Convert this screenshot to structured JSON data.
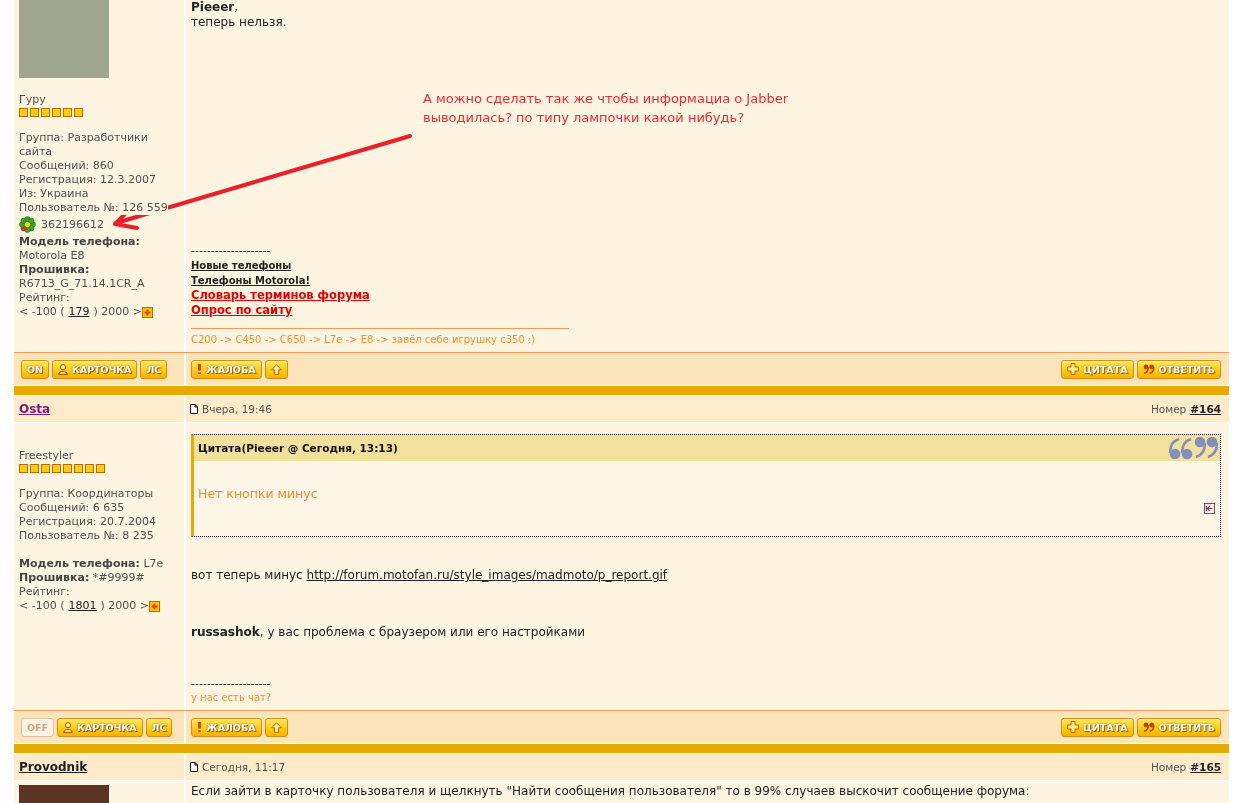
{
  "annotation": {
    "lines": [
      "А можно сделать так же чтобы информациа о Jabber",
      "выводилась? по типу лампочки какой нибудь?"
    ]
  },
  "posts": [
    {
      "avatar": true,
      "rank": "Гуру",
      "stars": 6,
      "profile": [
        [
          {
            "kind": "text",
            "text": "Группа: Разработчики сайта"
          },
          {
            "kind": "text",
            "text": "Сообщений: 860"
          },
          {
            "kind": "text",
            "text": "Регистрация: 12.3.2007"
          },
          {
            "kind": "text",
            "text": "Из: Украина"
          },
          {
            "kind": "text",
            "text": "Пользователь №: 126 559"
          },
          {
            "kind": "icq",
            "text": "362196612"
          },
          {
            "kind": "field",
            "label": "Модель телефона:",
            "value": "Motorola E8"
          },
          {
            "kind": "field",
            "label": "Прошивка:",
            "value": "R6713_G_71.14.1CR_A"
          },
          {
            "kind": "text",
            "text": "Рейтинг:"
          },
          {
            "kind": "rating",
            "before": "< -100 (",
            "value": "179",
            "after": ") 2000 >"
          }
        ]
      ],
      "blocks": [
        {
          "kind": "text",
          "lines": [
            "**Pieeer**,",
            "теперь нельзя."
          ]
        }
      ],
      "signature": [
        {
          "kind": "dashes",
          "text": "--------------------"
        },
        {
          "kind": "link",
          "text": "Новые телефоны"
        },
        {
          "kind": "link",
          "text": "Телефоны Motorola!"
        },
        {
          "kind": "promo",
          "text": "Словарь терминов форума"
        },
        {
          "kind": "promo",
          "text": "Опрос по сайту"
        },
        {
          "kind": "rule"
        },
        {
          "kind": "note",
          "text": "C200 -> C450 -> C650 -> L7e -> E8 -> завёл себе игрушку с350 :)"
        }
      ],
      "buttons": {
        "left": [
          {
            "kind": "status",
            "text": "ON",
            "on": true
          },
          {
            "kind": "profile",
            "text": "КАРТОЧКА"
          },
          {
            "kind": "pm",
            "text": "ЛС"
          }
        ],
        "middle": [
          {
            "kind": "report",
            "text": "ЖАЛОБА"
          },
          {
            "kind": "top"
          }
        ],
        "right": [
          {
            "kind": "quote",
            "text": "ЦИТАТА"
          },
          {
            "kind": "reply",
            "text": "ОТВЕТИТЬ"
          }
        ]
      }
    },
    {
      "header": {
        "author": "Osta",
        "visited": true,
        "date": "Вчера, 19:46",
        "number_label": "Номер",
        "number": "#164"
      },
      "rank": "Freestyler",
      "stars": 8,
      "profile": [
        [
          {
            "kind": "text",
            "text": "Группа: Координаторы"
          },
          {
            "kind": "text",
            "text": "Сообщений: 6 635"
          },
          {
            "kind": "text",
            "text": "Регистрация: 20.7.2004"
          },
          {
            "kind": "text",
            "text": "Пользователь №: 8 235"
          }
        ],
        [
          {
            "kind": "field",
            "label": "Модель телефона:",
            "value": "L7e"
          },
          {
            "kind": "field",
            "label": "Прошивка:",
            "value": "*#9999#"
          },
          {
            "kind": "text",
            "text": "Рейтинг:"
          },
          {
            "kind": "rating",
            "before": "< -100 (",
            "value": "1801",
            "after": ") 2000 >"
          }
        ]
      ],
      "blocks": [
        {
          "kind": "quote",
          "title": "Цитата(Pieeer @ Сегодня, 13:13)",
          "text": "Нет кнопки минус"
        },
        {
          "kind": "link_text",
          "text": "вот теперь минус",
          "link": "http://forum.motofan.ru/style_images/madmoto/p_report.gif"
        },
        {
          "kind": "text",
          "lines": [
            "**russashok**, у вас проблема с браузером или его настройками"
          ]
        }
      ],
      "signature": [
        {
          "kind": "dashes",
          "text": "--------------------"
        },
        {
          "kind": "note",
          "text": "у нас есть чат?"
        }
      ],
      "buttons": {
        "left": [
          {
            "kind": "status",
            "text": "OFF",
            "on": false
          },
          {
            "kind": "profile",
            "text": "КАРТОЧКА"
          },
          {
            "kind": "pm",
            "text": "ЛС"
          }
        ],
        "middle": [
          {
            "kind": "report",
            "text": "ЖАЛОБА"
          },
          {
            "kind": "top"
          }
        ],
        "right": [
          {
            "kind": "quote",
            "text": "ЦИТАТА"
          },
          {
            "kind": "reply",
            "text": "ОТВЕТИТЬ"
          }
        ]
      }
    },
    {
      "header": {
        "author": "Provodnik",
        "visited": false,
        "date": "Сегодня, 11:17",
        "number_label": "Номер",
        "number": "#165"
      },
      "avatar": true,
      "blocks": [
        {
          "kind": "text",
          "lines": [
            "Если зайти в карточку пользователя и щелкнуть \"Найти сообщения пользователя\" то в 99% случаев выскочит сообщение форума:"
          ]
        }
      ]
    }
  ]
}
